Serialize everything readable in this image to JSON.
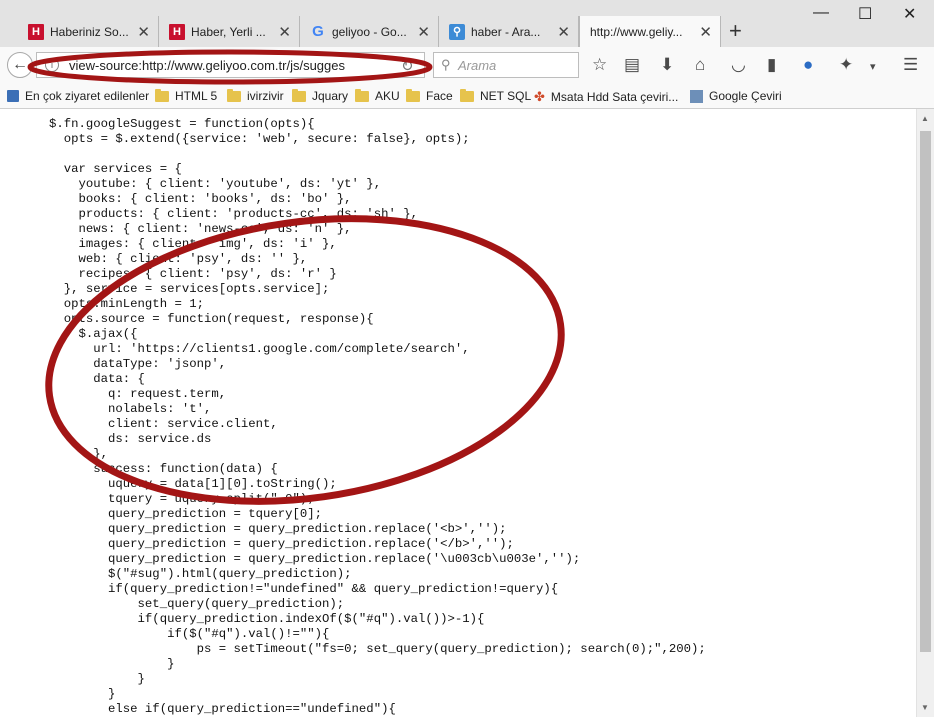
{
  "tabs": [
    {
      "title": "Haberiniz So...",
      "icon": "h-logo-icon"
    },
    {
      "title": "Haber, Yerli ...",
      "icon": "h-logo-icon"
    },
    {
      "title": "geliyoo - Go...",
      "icon": "google-icon"
    },
    {
      "title": "haber - Ara...",
      "icon": "search-icon"
    },
    {
      "title": "http://www.geliy...",
      "icon": "none",
      "active": true
    }
  ],
  "window": {
    "minimize": "—",
    "maximize": "☐",
    "close": "✕"
  },
  "nav": {
    "url": "view-source:http://www.geliyoo.com.tr/js/sugges",
    "search_placeholder": "Arama"
  },
  "bookmarks": [
    {
      "label": "En çok ziyaret edilenler",
      "icon": "bookmarks-icon"
    },
    {
      "label": "HTML 5",
      "icon": "folder-icon"
    },
    {
      "label": "ivirzivir",
      "icon": "folder-icon"
    },
    {
      "label": "Jquary",
      "icon": "folder-icon"
    },
    {
      "label": "AKU",
      "icon": "folder-icon"
    },
    {
      "label": "Face",
      "icon": "folder-icon"
    },
    {
      "label": "NET SQL",
      "icon": "folder-icon"
    },
    {
      "label": "Msata Hdd Sata çeviri...",
      "icon": "pinwheel-icon"
    },
    {
      "label": "Google Çeviri",
      "icon": "translate-icon"
    }
  ],
  "source_code": "$.fn.googleSuggest = function(opts){\n  opts = $.extend({service: 'web', secure: false}, opts);\n\n  var services = {\n    youtube: { client: 'youtube', ds: 'yt' },\n    books: { client: 'books', ds: 'bo' },\n    products: { client: 'products-cc', ds: 'sh' },\n    news: { client: 'news-cc', ds: 'n' },\n    images: { client: 'img', ds: 'i' },\n    web: { client: 'psy', ds: '' },\n    recipes: { client: 'psy', ds: 'r' }\n  }, service = services[opts.service];\n  opts.minLength = 1;\n  opts.source = function(request, response){\n    $.ajax({\n      url: 'https://clients1.google.com/complete/search',\n      dataType: 'jsonp',\n      data: {\n        q: request.term,\n        nolabels: 't',\n        client: service.client,\n        ds: service.ds\n      },\n      success: function(data) {\n        uquery = data[1][0].toString();\n        tquery = uquery.split(\",0\");\n        query_prediction = tquery[0];\n        query_prediction = query_prediction.replace('<b>','');\n        query_prediction = query_prediction.replace('</b>','');\n        query_prediction = query_prediction.replace('\\u003cb\\u003e','');\n        $(\"#sug\").html(query_prediction);\n        if(query_prediction!=\"undefined\" && query_prediction!=query){\n            set_query(query_prediction);\n            if(query_prediction.indexOf($(\"#q\").val())>-1){\n                if($(\"#q\").val()!=\"\"){\n                    ps = setTimeout(\"fs=0; set_query(query_prediction); search(0);\",200);\n                }\n            }\n        }\n        else if(query_prediction==\"undefined\"){",
  "colors": {
    "annotation": "#a31515",
    "tabbar": "#e3e3e3",
    "toolbar": "#f9f9f9"
  }
}
